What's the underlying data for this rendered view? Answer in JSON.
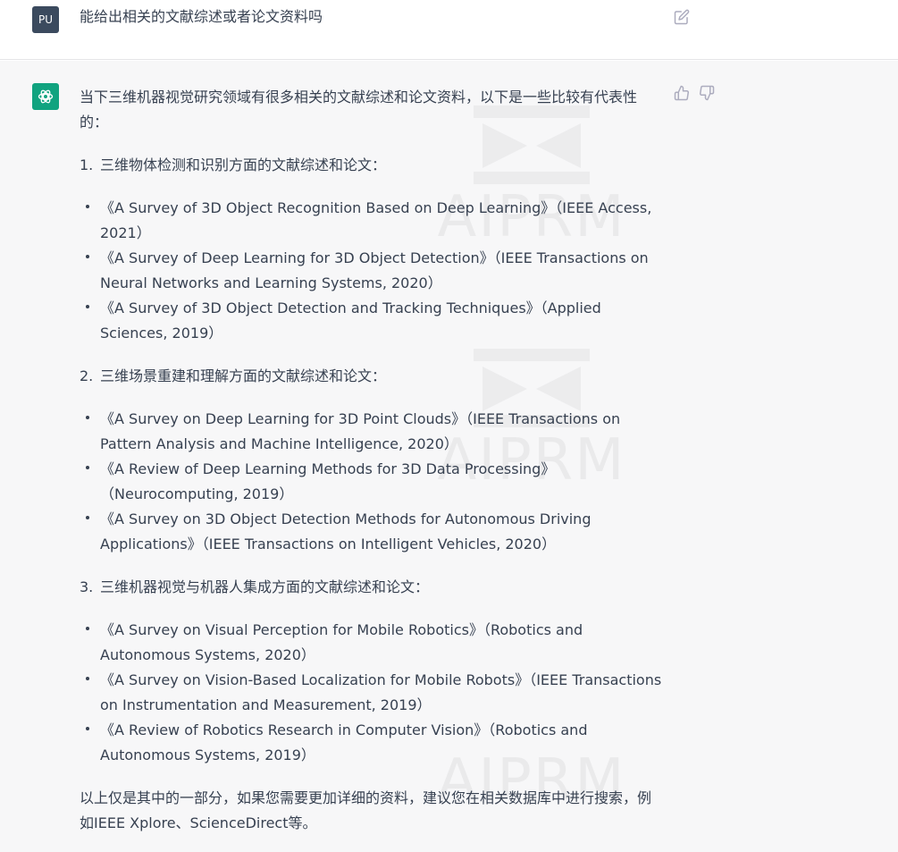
{
  "user": {
    "avatar_label": "PU",
    "message": "能给出相关的文献综述或者论文资料吗"
  },
  "assistant": {
    "intro": "当下三维机器视觉研究领域有很多相关的文献综述和论文资料，以下是一些比较有代表性的：",
    "sections": [
      {
        "number": "1.",
        "title": "三维物体检测和识别方面的文献综述和论文：",
        "items": [
          "《A Survey of 3D Object Recognition Based on Deep Learning》（IEEE Access, 2021）",
          "《A Survey of Deep Learning for 3D Object Detection》（IEEE Transactions on Neural Networks and Learning Systems, 2020）",
          "《A Survey of 3D Object Detection and Tracking Techniques》（Applied Sciences, 2019）"
        ]
      },
      {
        "number": "2.",
        "title": "三维场景重建和理解方面的文献综述和论文：",
        "items": [
          "《A Survey on Deep Learning for 3D Point Clouds》（IEEE Transactions on Pattern Analysis and Machine Intelligence, 2020）",
          "《A Review of Deep Learning Methods for 3D Data Processing》（Neurocomputing, 2019）",
          "《A Survey on 3D Object Detection Methods for Autonomous Driving Applications》（IEEE Transactions on Intelligent Vehicles, 2020）"
        ]
      },
      {
        "number": "3.",
        "title": "三维机器视觉与机器人集成方面的文献综述和论文：",
        "items": [
          "《A Survey on Visual Perception for Mobile Robotics》（Robotics and Autonomous Systems, 2020）",
          "《A Survey on Vision-Based Localization for Mobile Robots》（IEEE Transactions on Instrumentation and Measurement, 2019）",
          "《A Review of Robotics Research in Computer Vision》（Robotics and Autonomous Systems, 2019）"
        ]
      }
    ],
    "outro": "以上仅是其中的一部分，如果您需要更加详细的资料，建议您在相关数据库中进行搜索，例如IEEE Xplore、ScienceDirect等。"
  },
  "watermark": "AIPRM",
  "icons": {
    "edit": "edit-icon",
    "thumbs_up": "thumbs-up-icon",
    "thumbs_down": "thumbs-down-icon",
    "bot": "openai-logo-icon"
  },
  "colors": {
    "user_avatar_bg": "#3b4a5e",
    "bot_avatar_bg": "#10a37f",
    "assistant_bg": "#f7f7f8",
    "text": "#374151"
  }
}
